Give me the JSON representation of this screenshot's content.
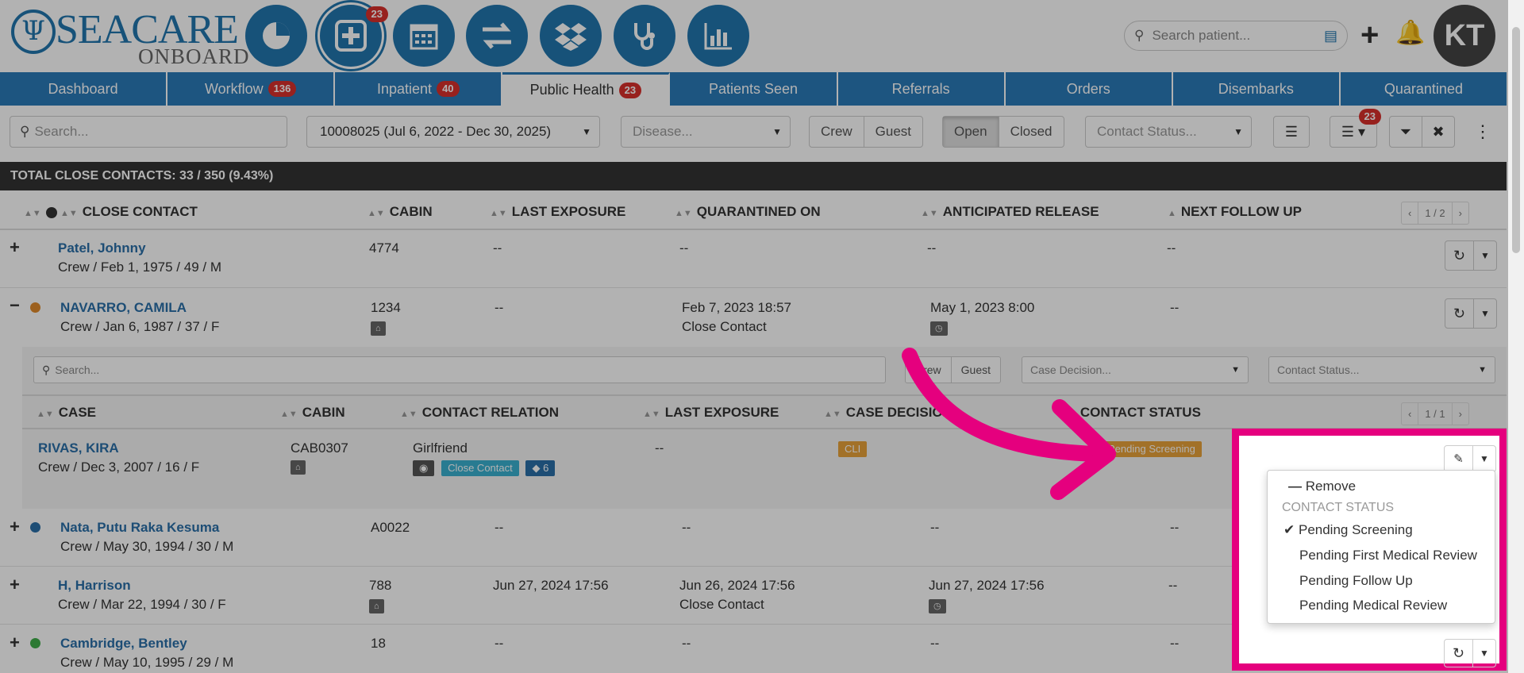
{
  "header": {
    "logo_top": "SEACARE",
    "logo_bottom": "ONBOARD",
    "workflow_badge": "23",
    "search_placeholder": "Search patient...",
    "avatar": "KT"
  },
  "tabs": [
    {
      "label": "Dashboard",
      "badge": ""
    },
    {
      "label": "Workflow",
      "badge": "136"
    },
    {
      "label": "Inpatient",
      "badge": "40"
    },
    {
      "label": "Public Health",
      "badge": "23"
    },
    {
      "label": "Patients Seen",
      "badge": ""
    },
    {
      "label": "Referrals",
      "badge": ""
    },
    {
      "label": "Orders",
      "badge": ""
    },
    {
      "label": "Disembarks",
      "badge": ""
    },
    {
      "label": "Quarantined",
      "badge": ""
    }
  ],
  "toolbar": {
    "search_placeholder": "Search...",
    "voyage": "10008025 (Jul 6, 2022 - Dec 30, 2025)",
    "disease_placeholder": "Disease...",
    "crew": "Crew",
    "guest": "Guest",
    "open": "Open",
    "closed": "Closed",
    "contact_status_placeholder": "Contact Status...",
    "list_badge": "23"
  },
  "total": "TOTAL CLOSE CONTACTS: 33 / 350 (9.43%)",
  "columns": {
    "close_contact": "CLOSE CONTACT",
    "cabin": "CABIN",
    "last_exposure": "LAST EXPOSURE",
    "quarantined_on": "QUARANTINED ON",
    "anticipated_release": "ANTICIPATED RELEASE",
    "next_follow_up": "NEXT FOLLOW UP",
    "pager": "1 / 2"
  },
  "rows": [
    {
      "name": "Patel, Johnny",
      "info": "Crew / Feb 1, 1975 / 49 / M",
      "cabin": "4774",
      "last_exposure": "--",
      "quarantined": "--",
      "quarantined_sub": "",
      "release": "--",
      "followup": "--"
    },
    {
      "name": "NAVARRO, CAMILA",
      "info": "Crew / Jan 6, 1987 / 37 / F",
      "cabin": "1234",
      "last_exposure": "--",
      "quarantined": "Feb 7, 2023 18:57",
      "quarantined_sub": "Close Contact",
      "release": "May 1, 2023 8:00",
      "followup": "--"
    },
    {
      "name": "Nata, Putu Raka Kesuma",
      "info": "Crew / May 30, 1994 / 30 / M",
      "cabin": "A0022",
      "last_exposure": "--",
      "quarantined": "--",
      "quarantined_sub": "",
      "release": "--",
      "followup": "--"
    },
    {
      "name": "H, Harrison",
      "info": "Crew / Mar 22, 1994 / 30 / F",
      "cabin": "788",
      "last_exposure": "Jun 27, 2024 17:56",
      "quarantined": "Jun 26, 2024 17:56",
      "quarantined_sub": "Close Contact",
      "release": "Jun 27, 2024 17:56",
      "followup": "--"
    },
    {
      "name": "Cambridge, Bentley",
      "info": "Crew / May 10, 1995 / 29 / M",
      "cabin": "18",
      "last_exposure": "--",
      "quarantined": "--",
      "quarantined_sub": "",
      "release": "--",
      "followup": "--"
    }
  ],
  "sub": {
    "search_placeholder": "Search...",
    "crew": "Crew",
    "guest": "Guest",
    "case_decision_placeholder": "Case Decision...",
    "contact_status_placeholder": "Contact Status...",
    "columns": {
      "case": "CASE",
      "cabin": "CABIN",
      "relation": "CONTACT RELATION",
      "last_exposure": "LAST EXPOSURE",
      "decision": "CASE DECISION",
      "status": "CONTACT STATUS",
      "pager": "1 / 1"
    },
    "row": {
      "name": "RIVAS, KIRA",
      "info": "Crew / Dec 3, 2007 / 16 / F",
      "cabin": "CAB0307",
      "relation": "Girlfriend",
      "tag": "Close Contact",
      "count": "6",
      "last_exposure": "--",
      "decision": "CLI",
      "status": "Pending Screening"
    }
  },
  "dropdown": {
    "remove": "Remove",
    "header": "CONTACT STATUS",
    "items": [
      "Pending Screening",
      "Pending First Medical Review",
      "Pending Follow Up",
      "Pending Medical Review"
    ]
  }
}
